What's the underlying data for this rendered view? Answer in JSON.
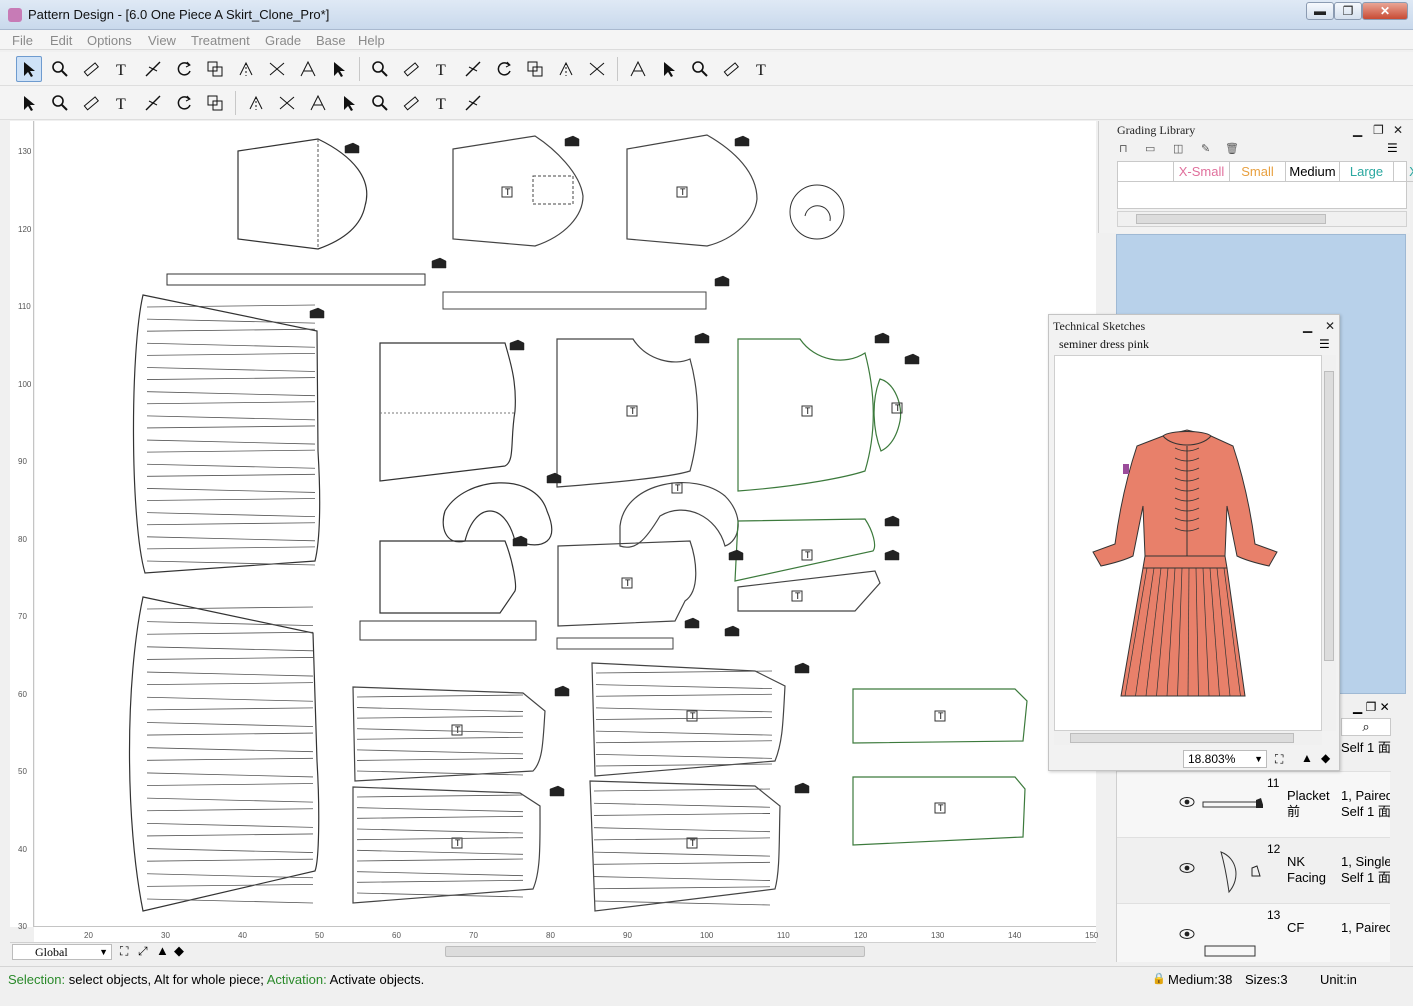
{
  "window": {
    "title": "Pattern Design - [6.0 One Piece A Skirt_Clone_Pro*]",
    "minimize": "▬",
    "restore": "❐",
    "close": "✕"
  },
  "menu": [
    "File",
    "Edit",
    "Options",
    "View",
    "Treatment",
    "Grade",
    "Base",
    "Help"
  ],
  "toolbar1": [
    "select-tool",
    "zoom-tool",
    "measure-tool",
    "text-tool",
    "cut-tool",
    "rotate-tool",
    "copy-tool",
    "mirror-tool",
    "notch-tool",
    "dart-tool",
    "fold-tool",
    "circle-tool",
    "rectangle-tool",
    "polygon-tool",
    "line-tool",
    "curve-tool",
    "edit-tool",
    "seam-tool",
    "target-tool",
    "split-tool",
    "merge-tool",
    "axis-tool",
    "align-tool",
    "scale-tool"
  ],
  "toolbar2": [
    "pleat-tool",
    "vertical-pleat-tool",
    "spread-tool",
    "triangle-tool",
    "move-tool",
    "shape-tool",
    "flip-tool",
    "box-tool",
    "frame-tool",
    "arrow-tool",
    "drop-tool",
    "hand-tool",
    "rotate-left-tool",
    "corner-tool",
    "angle-tool"
  ],
  "ruler": {
    "vertical": [
      "130",
      "120",
      "110",
      "100",
      "90",
      "80",
      "70",
      "60",
      "50",
      "40",
      "30"
    ],
    "horizontal": [
      "20",
      "30",
      "40",
      "50",
      "60",
      "70",
      "80",
      "90",
      "100",
      "110",
      "120",
      "130",
      "140",
      "150"
    ]
  },
  "canvas": {
    "piece_label": "T",
    "view_mode": "Global"
  },
  "grading_library": {
    "title": "Grading Library",
    "sizes": [
      {
        "label": "X-Small",
        "color": "#e0709c"
      },
      {
        "label": "Small",
        "color": "#e8a040"
      },
      {
        "label": "Medium",
        "color": "#000000"
      },
      {
        "label": "Large",
        "color": "#2aa8a0"
      },
      {
        "label": "X",
        "color": "#2aa8a0"
      }
    ]
  },
  "technical_sketches": {
    "title": "Technical Sketches",
    "sketch_name": "seminer dress pink",
    "zoom": "18.803%",
    "dress_color": "#e8806a"
  },
  "pieces": [
    {
      "num": "",
      "name": "",
      "qty1": "",
      "qty2": "Self 1 面"
    },
    {
      "num": "11",
      "name": "Placket",
      "name2": "前",
      "qty1": "1, Paired",
      "qty2": "Self 1 面"
    },
    {
      "num": "12",
      "name": "NK",
      "name2": "Facing",
      "qty1": "1, Single",
      "qty2": "Self 1 面"
    },
    {
      "num": "13",
      "name": "CF",
      "name2": "",
      "qty1": "1, Paired",
      "qty2": ""
    }
  ],
  "status": {
    "sel_kw": "Selection:",
    "sel_text": "select objects, Alt for whole piece;",
    "act_kw": "Activation:",
    "act_text": "Activate objects.",
    "size": "Medium:38",
    "sizes": "Sizes:3",
    "unit": "Unit:in"
  }
}
